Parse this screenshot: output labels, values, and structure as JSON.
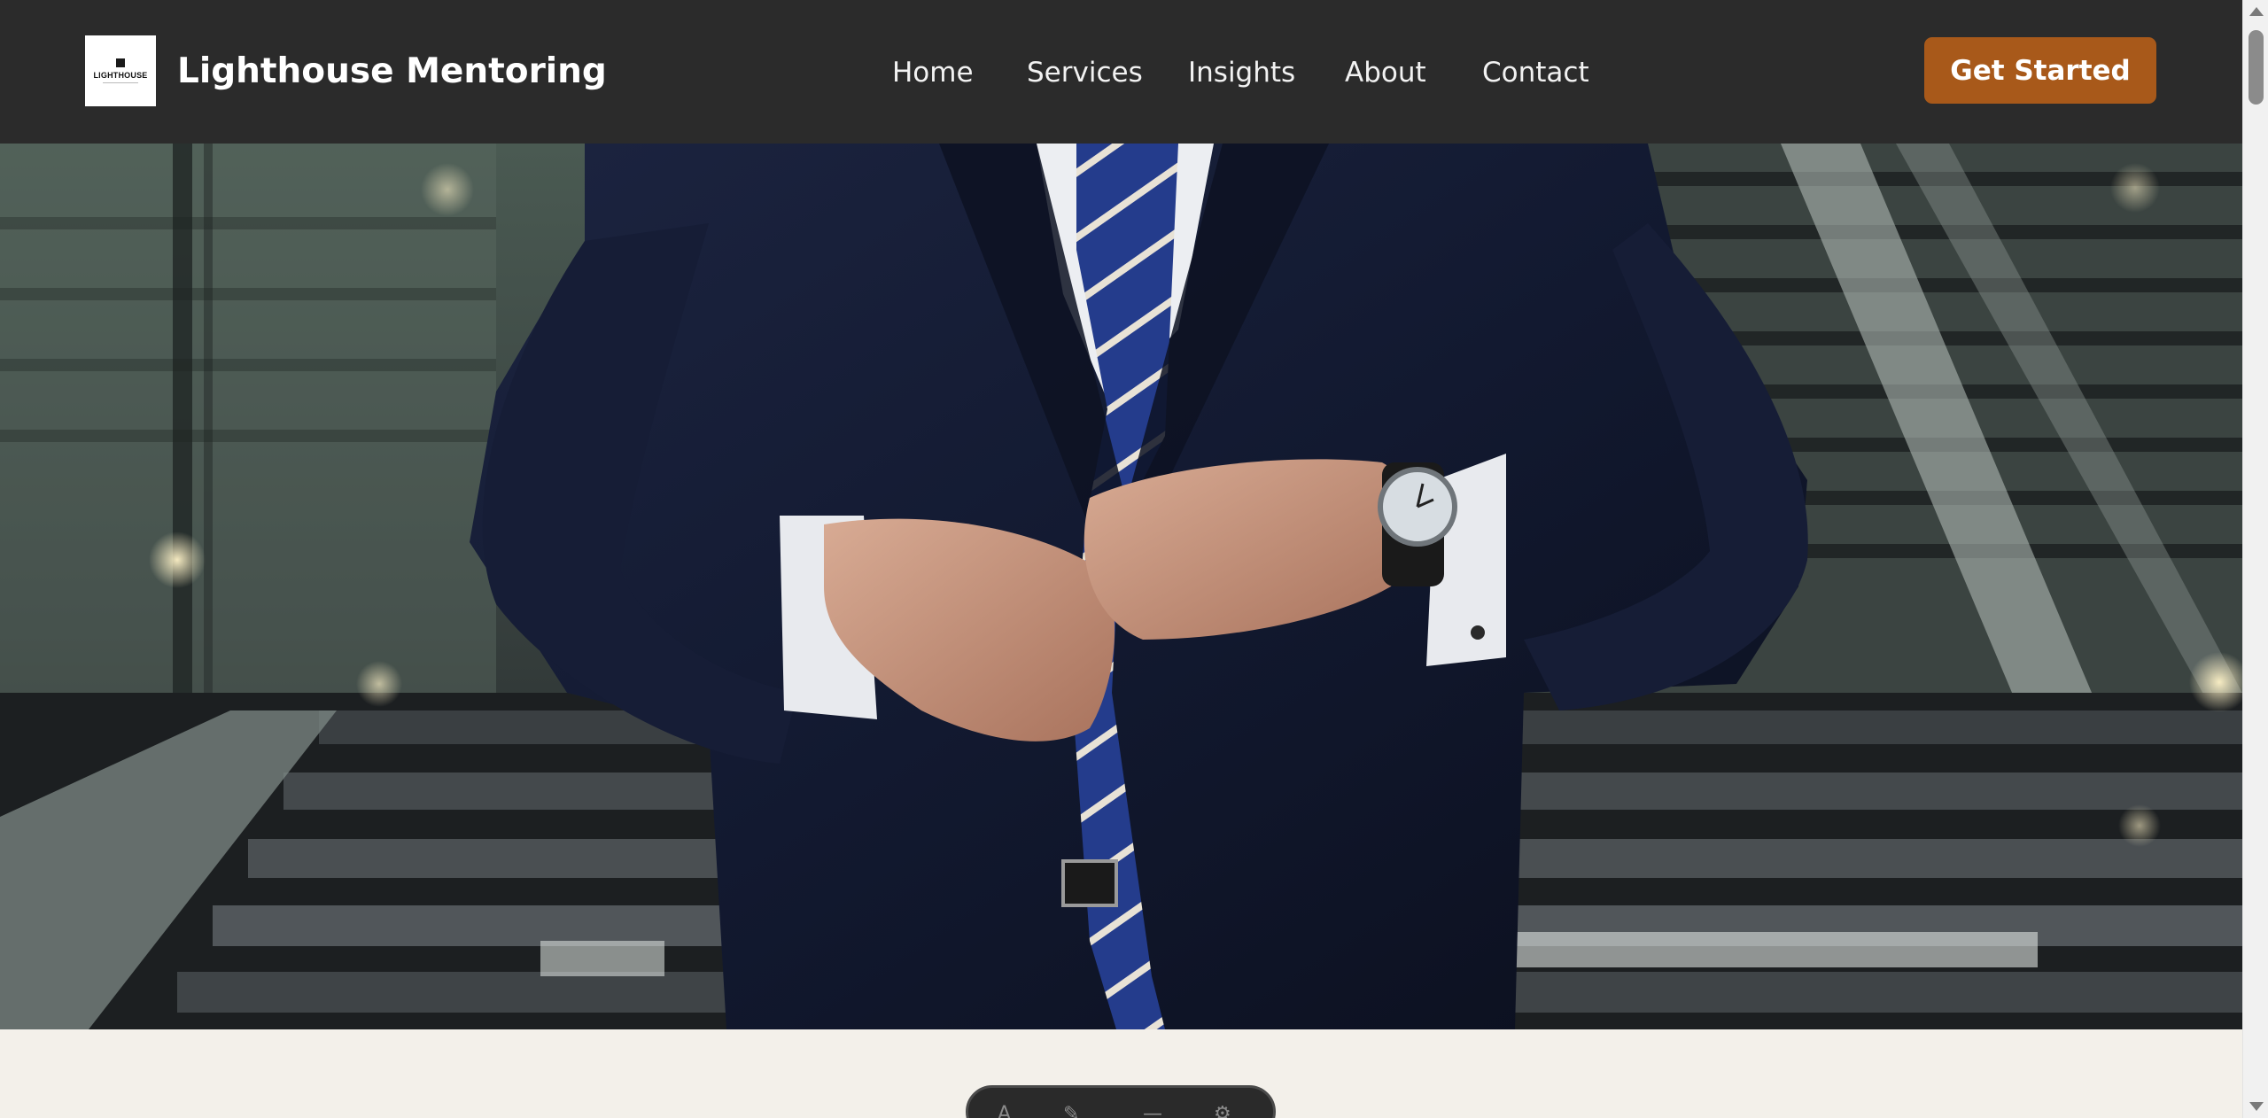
{
  "header": {
    "logo": {
      "word": "LIGHTHOUSE",
      "icon": "lighthouse-logo-icon"
    },
    "brand_name": "Lighthouse Mentoring",
    "nav": [
      {
        "label": "Home"
      },
      {
        "label": "Services"
      },
      {
        "label": "Insights"
      },
      {
        "label": "About"
      },
      {
        "label": "Contact"
      }
    ],
    "cta_label": "Get Started"
  },
  "hero": {
    "image": "businessman-in-navy-suit-buttoning-jacket-photo"
  },
  "colors": {
    "header_bg": "#2b2b2b",
    "accent": "#a8591a",
    "page_bg": "#f3f0ea",
    "suit_navy": "#141a2e",
    "tie_blue": "#243c8c"
  }
}
